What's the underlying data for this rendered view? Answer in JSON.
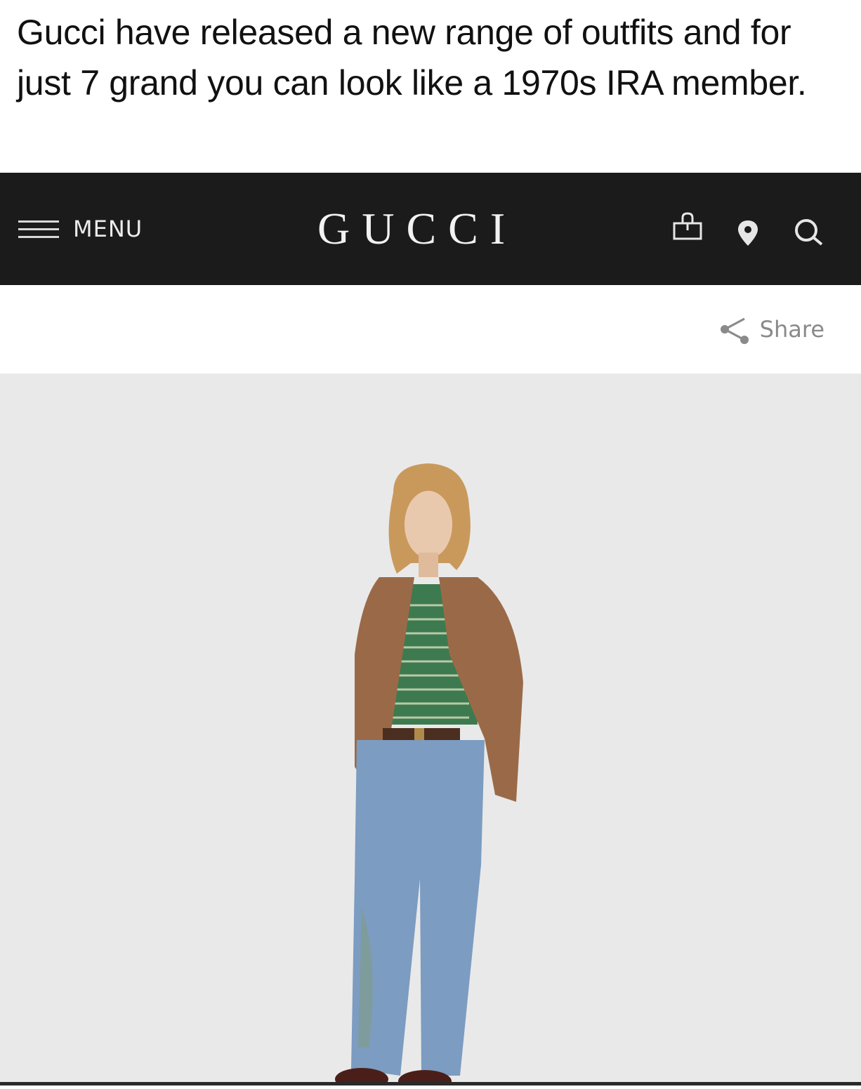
{
  "caption": {
    "text": "Gucci have released a new range of outfits and for just 7 grand you can look like a 1970s IRA member."
  },
  "navbar": {
    "menu_label": "MENU",
    "brand": "GUCCI",
    "icons": [
      "shopping-bag-icon",
      "location-pin-icon",
      "search-icon"
    ]
  },
  "share": {
    "label": "Share",
    "icon": "share-icon"
  },
  "colors": {
    "navbar_bg": "#1b1b1b",
    "product_bg": "#e9e9e9",
    "jacket": "#9a6a48",
    "jeans": "#7c9cc1"
  }
}
